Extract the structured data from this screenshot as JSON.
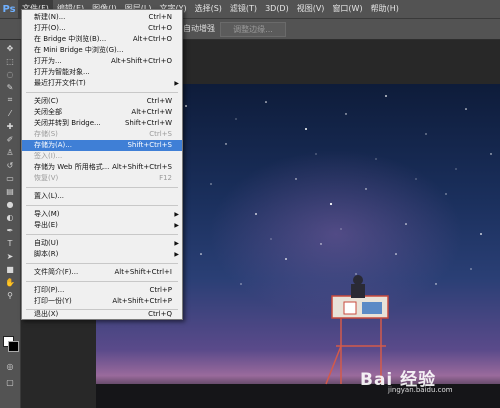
{
  "app": {
    "logo": "Ps"
  },
  "menubar": {
    "items": [
      "文件(F)",
      "编辑(E)",
      "图像(I)",
      "图层(L)",
      "文字(Y)",
      "选择(S)",
      "滤镜(T)",
      "3D(D)",
      "视图(V)",
      "窗口(W)",
      "帮助(H)"
    ]
  },
  "options_bar": {
    "label": "自动增强",
    "button_label": "调整边缘..."
  },
  "file_menu": {
    "items": [
      {
        "label": "新建(N)...",
        "shortcut": "Ctrl+N"
      },
      {
        "label": "打开(O)...",
        "shortcut": "Ctrl+O"
      },
      {
        "label": "在 Bridge 中浏览(B)...",
        "shortcut": "Alt+Ctrl+O"
      },
      {
        "label": "在 Mini Bridge 中浏览(G)...",
        "shortcut": ""
      },
      {
        "label": "打开为...",
        "shortcut": "Alt+Shift+Ctrl+O"
      },
      {
        "label": "打开为智能对象...",
        "shortcut": ""
      },
      {
        "label": "最近打开文件(T)",
        "shortcut": ""
      },
      {
        "label": "关闭(C)",
        "shortcut": "Ctrl+W"
      },
      {
        "label": "关闭全部",
        "shortcut": "Alt+Ctrl+W"
      },
      {
        "label": "关闭并转到 Bridge...",
        "shortcut": "Shift+Ctrl+W"
      },
      {
        "label": "存储(S)",
        "shortcut": "Ctrl+S"
      },
      {
        "label": "存储为(A)...",
        "shortcut": "Shift+Ctrl+S"
      },
      {
        "label": "签入(I)...",
        "shortcut": ""
      },
      {
        "label": "存储为 Web 所用格式...",
        "shortcut": "Alt+Shift+Ctrl+S"
      },
      {
        "label": "恢复(V)",
        "shortcut": "F12"
      },
      {
        "label": "置入(L)...",
        "shortcut": ""
      },
      {
        "label": "导入(M)",
        "shortcut": ""
      },
      {
        "label": "导出(E)",
        "shortcut": ""
      },
      {
        "label": "自动(U)",
        "shortcut": ""
      },
      {
        "label": "脚本(R)",
        "shortcut": ""
      },
      {
        "label": "文件简介(F)...",
        "shortcut": "Alt+Shift+Ctrl+I"
      },
      {
        "label": "打印(P)...",
        "shortcut": "Ctrl+P"
      },
      {
        "label": "打印一份(Y)",
        "shortcut": "Alt+Shift+Ctrl+P"
      },
      {
        "label": "退出(X)",
        "shortcut": "Ctrl+Q"
      }
    ]
  },
  "watermark": {
    "main": "Bai 经验",
    "sub": "jingyan.baidu.com"
  }
}
